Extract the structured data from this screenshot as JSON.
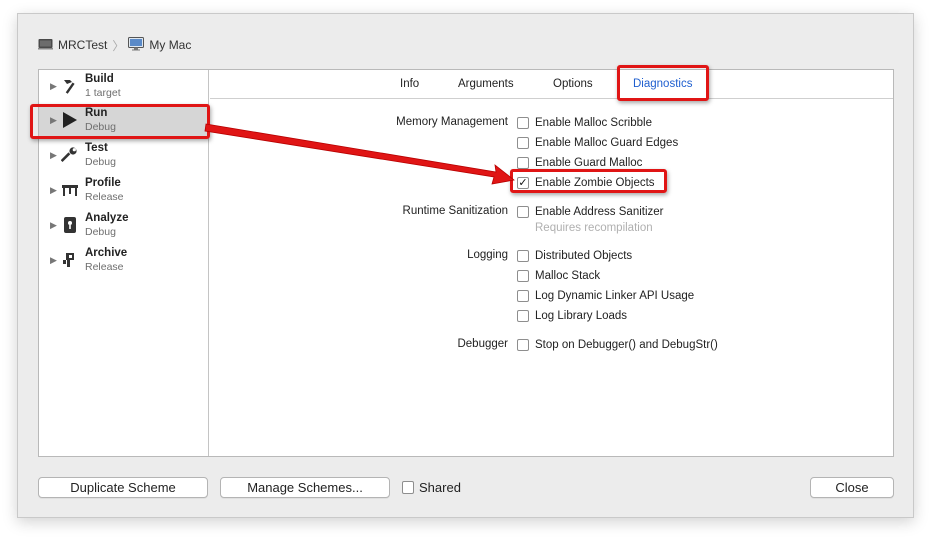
{
  "breadcrumb": {
    "project": "MRCTest",
    "destination": "My Mac"
  },
  "sidebar": {
    "items": [
      {
        "title": "Build",
        "subtitle": "1 target",
        "icon": "hammer-icon"
      },
      {
        "title": "Run",
        "subtitle": "Debug",
        "icon": "play-icon"
      },
      {
        "title": "Test",
        "subtitle": "Debug",
        "icon": "wrench-icon"
      },
      {
        "title": "Profile",
        "subtitle": "Release",
        "icon": "gauge-icon"
      },
      {
        "title": "Analyze",
        "subtitle": "Debug",
        "icon": "analyze-icon"
      },
      {
        "title": "Archive",
        "subtitle": "Release",
        "icon": "archive-icon"
      }
    ],
    "selected": "Run"
  },
  "tabs": {
    "info": "Info",
    "arguments": "Arguments",
    "options": "Options",
    "diagnostics": "Diagnostics",
    "active": "Diagnostics"
  },
  "diagnostics": {
    "memory_management": {
      "label": "Memory Management",
      "options": [
        {
          "label": "Enable Malloc Scribble",
          "checked": false
        },
        {
          "label": "Enable Malloc Guard Edges",
          "checked": false
        },
        {
          "label": "Enable Guard Malloc",
          "checked": false
        },
        {
          "label": "Enable Zombie Objects",
          "checked": true
        }
      ]
    },
    "runtime_sanitization": {
      "label": "Runtime Sanitization",
      "options": [
        {
          "label": "Enable Address Sanitizer",
          "checked": false
        }
      ],
      "hint": "Requires recompilation"
    },
    "logging": {
      "label": "Logging",
      "options": [
        {
          "label": "Distributed Objects",
          "checked": false
        },
        {
          "label": "Malloc Stack",
          "checked": false
        },
        {
          "label": "Log Dynamic Linker API Usage",
          "checked": false
        },
        {
          "label": "Log Library Loads",
          "checked": false
        }
      ]
    },
    "debugger": {
      "label": "Debugger",
      "options": [
        {
          "label": "Stop on Debugger() and DebugStr()",
          "checked": false
        }
      ]
    }
  },
  "footer": {
    "duplicate_label": "Duplicate Scheme",
    "manage_label": "Manage Schemes...",
    "shared_label": "Shared",
    "shared_checked": false,
    "close_label": "Close"
  },
  "colors": {
    "annotation": "#e01515",
    "active_tab": "#1f5fcf",
    "selected_row": "#d6d6d6"
  }
}
